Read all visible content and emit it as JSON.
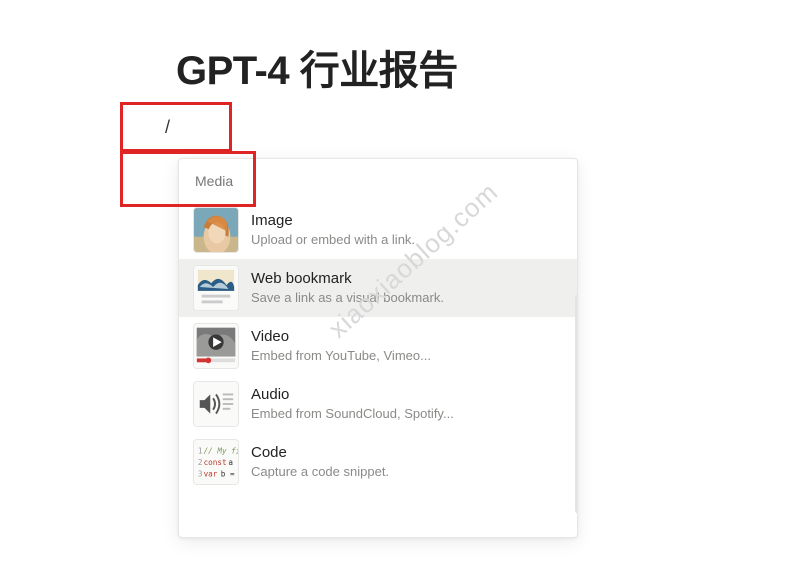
{
  "page": {
    "title": "GPT-4 行业报告",
    "slash": "/"
  },
  "menu": {
    "section": "Media",
    "items": [
      {
        "title": "Image",
        "desc": "Upload or embed with a link."
      },
      {
        "title": "Web bookmark",
        "desc": "Save a link as a visual bookmark."
      },
      {
        "title": "Video",
        "desc": "Embed from YouTube, Vimeo..."
      },
      {
        "title": "Audio",
        "desc": "Embed from SoundCloud, Spotify..."
      },
      {
        "title": "Code",
        "desc": "Capture a code snippet."
      }
    ]
  },
  "watermark": "xiaoxiaoblog.com"
}
